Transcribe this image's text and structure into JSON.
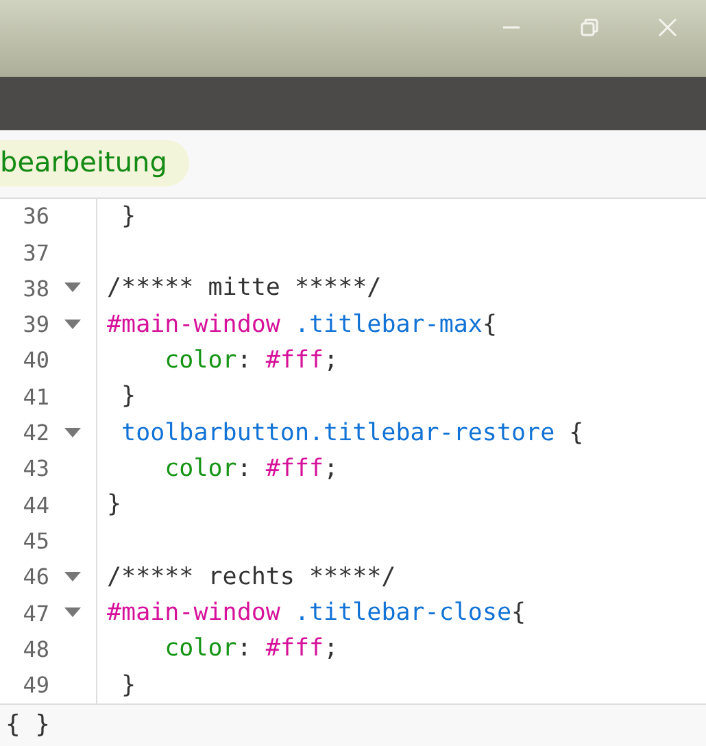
{
  "tab": {
    "label": "bearbeitung",
    "selected": true
  },
  "code_lines": [
    {
      "number": "36",
      "foldable": false,
      "tokens": [
        {
          "kind": "plain",
          "text": " }"
        }
      ]
    },
    {
      "number": "37",
      "foldable": false
    },
    {
      "number": "38",
      "foldable": true,
      "tokens": [
        {
          "kind": "comment",
          "text": "/***** mitte *****/"
        }
      ]
    },
    {
      "number": "39",
      "foldable": true,
      "tokens": [
        {
          "kind": "id",
          "text": "#main-window"
        },
        {
          "kind": "class",
          "text": " .titlebar-max"
        },
        {
          "kind": "plain",
          "text": "{"
        }
      ]
    },
    {
      "number": "40",
      "foldable": false,
      "tokens": [
        {
          "kind": "property",
          "text": "    color"
        },
        {
          "kind": "plain",
          "text": ": "
        },
        {
          "kind": "value",
          "text": "#fff"
        },
        {
          "kind": "plain",
          "text": ";"
        }
      ]
    },
    {
      "number": "41",
      "foldable": false,
      "tokens": [
        {
          "kind": "plain",
          "text": " }"
        }
      ]
    },
    {
      "number": "42",
      "foldable": true,
      "tokens": [
        {
          "kind": "class",
          "text": " toolbarbutton.titlebar-restore"
        },
        {
          "kind": "plain",
          "text": " {"
        }
      ]
    },
    {
      "number": "43",
      "foldable": false,
      "tokens": [
        {
          "kind": "property",
          "text": "    color"
        },
        {
          "kind": "plain",
          "text": ": "
        },
        {
          "kind": "value",
          "text": "#fff"
        },
        {
          "kind": "plain",
          "text": ";"
        }
      ]
    },
    {
      "number": "44",
      "foldable": false,
      "tokens": [
        {
          "kind": "plain",
          "text": "}"
        }
      ]
    },
    {
      "number": "45",
      "foldable": false
    },
    {
      "number": "46",
      "foldable": true,
      "tokens": [
        {
          "kind": "comment",
          "text": "/***** rechts *****/"
        }
      ]
    },
    {
      "number": "47",
      "foldable": true,
      "tokens": [
        {
          "kind": "id",
          "text": "#main-window"
        },
        {
          "kind": "class",
          "text": " .titlebar-close"
        },
        {
          "kind": "plain",
          "text": "{"
        }
      ]
    },
    {
      "number": "48",
      "foldable": false,
      "tokens": [
        {
          "kind": "property",
          "text": "    color"
        },
        {
          "kind": "plain",
          "text": ": "
        },
        {
          "kind": "value",
          "text": "#fff"
        },
        {
          "kind": "plain",
          "text": ";"
        }
      ]
    },
    {
      "number": "49",
      "foldable": false,
      "tokens": [
        {
          "kind": "plain",
          "text": " }"
        }
      ]
    }
  ],
  "status_bar": {
    "label": "{ }"
  }
}
